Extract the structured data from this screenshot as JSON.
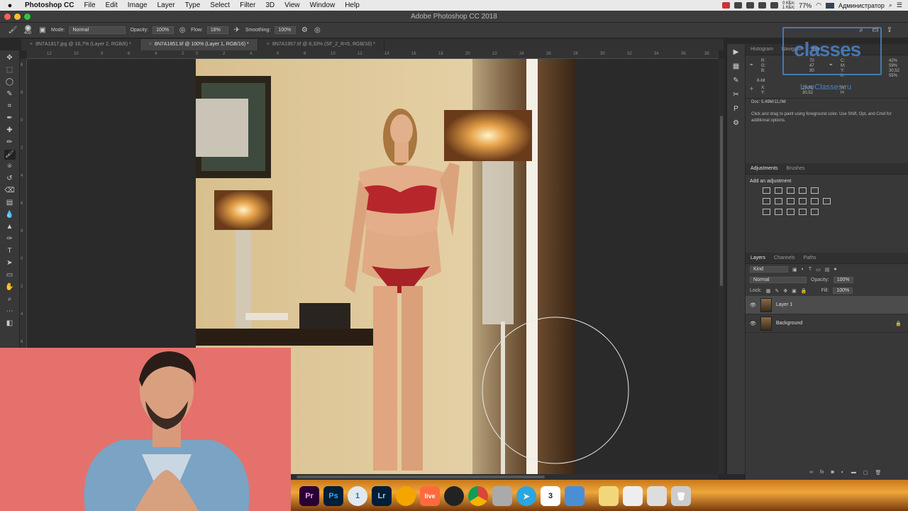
{
  "menubar": {
    "app_name": "Photoshop CC",
    "items": [
      "File",
      "Edit",
      "Image",
      "Layer",
      "Type",
      "Select",
      "Filter",
      "3D",
      "View",
      "Window",
      "Help"
    ],
    "battery": "77%",
    "user": "Администратор",
    "net_up": "0 КБ/с",
    "net_down": "1 КБ/с"
  },
  "window": {
    "title": "Adobe Photoshop CC 2018"
  },
  "options": {
    "brush_size": "400",
    "mode_label": "Mode:",
    "mode_value": "Normal",
    "opacity_label": "Opacity:",
    "opacity_value": "100%",
    "flow_label": "Flow:",
    "flow_value": "18%",
    "smoothing_label": "Smoothing:",
    "smoothing_value": "100%"
  },
  "tabs": [
    {
      "label": "8N7A1817.jpg @ 16,7% (Layer 2, RGB/8) *"
    },
    {
      "label": "8N7A1851.tif @ 100% (Layer 1, RGB/16) *"
    },
    {
      "label": "8N7A1957.tif @ 8,33% (SF_2_R=5, RGB/16) *"
    }
  ],
  "hruler_ticks": [
    "12",
    "10",
    "8",
    "6",
    "4",
    "2",
    "0",
    "2",
    "4",
    "6",
    "8",
    "10",
    "12",
    "14",
    "16",
    "18",
    "20",
    "22",
    "24",
    "26",
    "28",
    "30",
    "32",
    "34",
    "36",
    "38"
  ],
  "vruler_ticks": [
    "6",
    "8",
    "0",
    "2",
    "4",
    "6",
    "8",
    "0",
    "2",
    "4",
    "6",
    "8"
  ],
  "info_panel": {
    "tabs": [
      "Histogram",
      "Navigator",
      "Info"
    ],
    "r": "R:",
    "g": "G:",
    "b": "B:",
    "r_val": "70",
    "g_val": "47",
    "b_val": "30",
    "c": "C:",
    "m": "M:",
    "y": "Y:",
    "k": "K:",
    "c_val": "42%",
    "m_val": "59%",
    "y_val": "30,52",
    "k_val": "55%",
    "bit": "8-bit",
    "x": "X:",
    "yy": "Y:",
    "x_val": "25,81",
    "w": "W:",
    "h": "H:",
    "doc": "Doc: 5,49M/11,0M",
    "hint": "Click and drag to paint using foreground color. Use Shift, Opt, and Cmd for additional options."
  },
  "adjustments": {
    "tabs": [
      "Adjustments",
      "Brushes"
    ],
    "add_label": "Add an adjustment"
  },
  "layers_panel": {
    "tabs": [
      "Layers",
      "Channels",
      "Paths"
    ],
    "kind": "Kind",
    "blend": "Normal",
    "opacity_label": "Opacity:",
    "opacity_value": "100%",
    "lock_label": "Lock:",
    "fill_label": "Fill:",
    "fill_value": "100%",
    "layers": [
      {
        "name": "Layer 1",
        "selected": true
      },
      {
        "name": "Background",
        "selected": false
      }
    ]
  },
  "watermark": {
    "logo": "classes",
    "site": "LiveClasses.ru"
  },
  "dock": {
    "apps": [
      "Pr",
      "Ps",
      "1",
      "Lr",
      "live",
      "3"
    ]
  },
  "colors": {
    "accent": "#4a83c9",
    "dock": "#f0a63a",
    "cam_bg": "#e4706b"
  }
}
